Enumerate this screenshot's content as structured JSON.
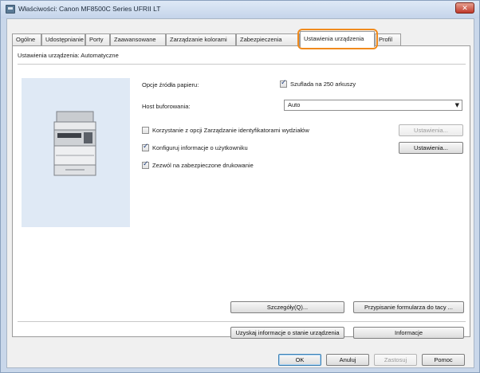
{
  "window": {
    "title": "Właściwości: Canon MF8500C Series UFRII LT",
    "close_glyph": "✕"
  },
  "tabs": [
    {
      "label": "Ogólne"
    },
    {
      "label": "Udostępnianie"
    },
    {
      "label": "Porty"
    },
    {
      "label": "Zaawansowane"
    },
    {
      "label": "Zarządzanie kolorami"
    },
    {
      "label": "Zabezpieczenia"
    },
    {
      "label": "Ustawienia urządzenia",
      "active": true
    },
    {
      "label": "Profil"
    }
  ],
  "panel": {
    "mode_label": "Ustawienia urządzenia: Automatyczne",
    "paper_source": {
      "label": "Opcje źródła papieru:",
      "option_label": "Szuflada na 250 arkuszy",
      "checked": true
    },
    "spooling": {
      "label": "Host buforowania:",
      "value": "Auto"
    },
    "dept_id": {
      "label": "Korzystanie z opcji Zarządzanie identyfikatorami wydziałów",
      "checked": false,
      "button_label": "Ustawienia..."
    },
    "user_info": {
      "label": "Konfiguruj informacje o użytkowniku",
      "checked": true,
      "button_label": "Ustawienia..."
    },
    "secure_print": {
      "label": "Zezwól na zabezpieczone drukowanie",
      "checked": true
    },
    "details_button": "Szczegóły(Q)...",
    "form_to_tray_button": "Przypisanie formularza do tacy ...",
    "get_status_button": "Uzyskaj informacje o stanie urządzenia",
    "about_button": "Informacje"
  },
  "footer": {
    "ok": "OK",
    "cancel": "Anuluj",
    "apply": "Zastosuj",
    "help": "Pomoc"
  },
  "colors": {
    "highlight": "#f08a1c",
    "title_bar": "#c4d4ea",
    "preview_bg": "#dfe9f5"
  }
}
